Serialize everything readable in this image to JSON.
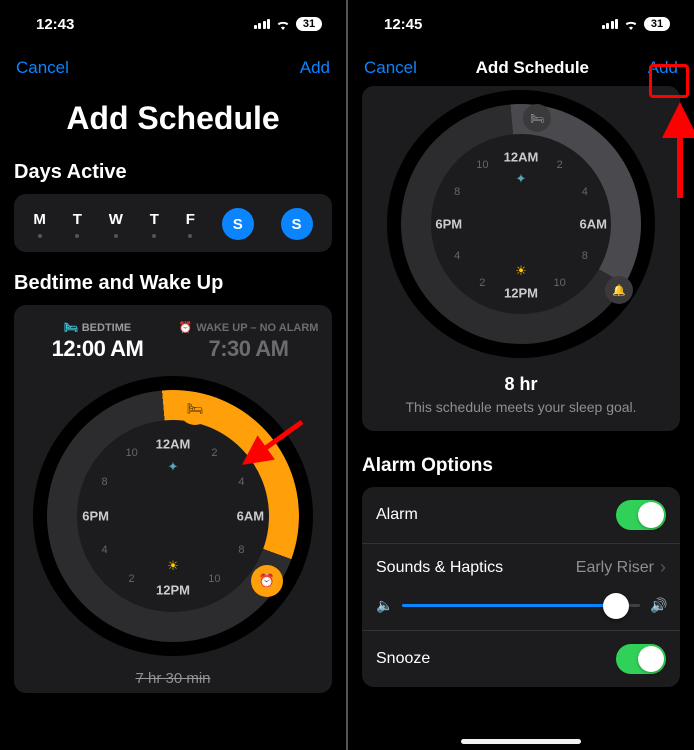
{
  "left": {
    "status": {
      "time": "12:43",
      "battery": "31"
    },
    "nav": {
      "cancel": "Cancel",
      "add": "Add"
    },
    "title": "Add Schedule",
    "days": {
      "label": "Days Active",
      "items": [
        {
          "letter": "M",
          "selected": false
        },
        {
          "letter": "T",
          "selected": false
        },
        {
          "letter": "W",
          "selected": false
        },
        {
          "letter": "T",
          "selected": false
        },
        {
          "letter": "F",
          "selected": false
        },
        {
          "letter": "S",
          "selected": true
        },
        {
          "letter": "S",
          "selected": true
        }
      ]
    },
    "bedtime": {
      "label": "Bedtime and Wake Up",
      "bed_label": "BEDTIME",
      "bed_time": "12:00 AM",
      "wake_label": "WAKE UP – NO ALARM",
      "wake_time": "7:30 AM",
      "duration_strike": "7 hr 30 min",
      "face": {
        "top": "12AM",
        "right": "6AM",
        "bottom": "12PM",
        "left": "6PM"
      }
    }
  },
  "right": {
    "status": {
      "time": "12:45",
      "battery": "31"
    },
    "nav": {
      "cancel": "Cancel",
      "title": "Add Schedule",
      "add": "Add"
    },
    "clock_face": {
      "top": "12AM",
      "right": "6AM",
      "bottom": "12PM",
      "left": "6PM"
    },
    "goal": {
      "duration": "8 hr",
      "note": "This schedule meets your sleep goal."
    },
    "alarm_options": {
      "label": "Alarm Options",
      "alarm_row": "Alarm",
      "sounds_row": "Sounds & Haptics",
      "sounds_value": "Early Riser",
      "snooze_row": "Snooze",
      "alarm_on": true,
      "snooze_on": true,
      "volume_pct": 90
    }
  }
}
